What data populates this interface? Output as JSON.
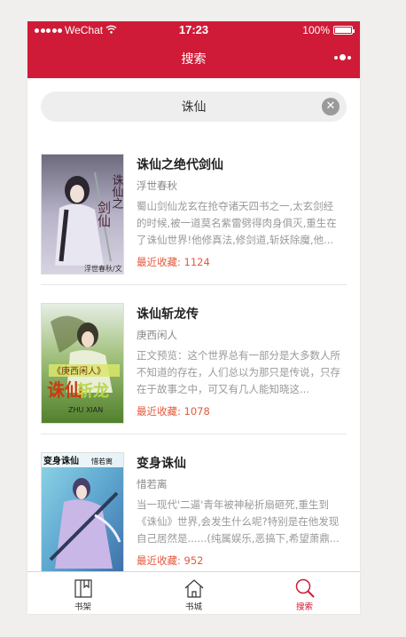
{
  "status_bar": {
    "carrier": "WeChat",
    "time": "17:23",
    "battery": "100%"
  },
  "nav": {
    "title": "搜索",
    "more_icon": "more-dots-icon"
  },
  "search": {
    "value": "诛仙",
    "clear_icon": "clear-icon"
  },
  "books": [
    {
      "title": "诛仙之绝代剑仙",
      "author": "浮世春秋",
      "description": "蜀山剑仙龙玄在抢夺诸天四书之一,太玄剑经的时候,被一道莫名紫雷劈得肉身俱灭,重生在了诛仙世界!他修真法,修剑道,斩妖除魔,他...",
      "favorites": "最近收藏: 1124",
      "cover_text": "诛仙之绝代剑仙",
      "cover_author": "浮世春秋/文"
    },
    {
      "title": "诛仙斩龙传",
      "author": "庚西闲人",
      "description": "正文预览：这个世界总有一部分是大多数人所不知道的存在，人们总以为那只是传说，只存在于故事之中，可又有几人能知晓这...",
      "favorites": "最近收藏: 1078",
      "cover_text": "诛仙斩龙传",
      "cover_author": "庚西闲人"
    },
    {
      "title": "变身诛仙",
      "author": "惜若离",
      "description": "当一现代'二逼'青年被神秘折扇砸死,重生到《诛仙》世界,会发生什么呢?特别是在他发现自己居然是......(纯属娱乐,恶搞下,希望萧鼎...",
      "favorites": "最近收藏: 952",
      "cover_text": "变身诛仙",
      "cover_author": "惜若离"
    }
  ],
  "tabs": [
    {
      "label": "书架",
      "icon": "bookshelf-icon",
      "active": false
    },
    {
      "label": "书城",
      "icon": "home-icon",
      "active": false
    },
    {
      "label": "搜索",
      "icon": "search-icon",
      "active": true
    }
  ],
  "colors": {
    "brand": "#cf1b37",
    "favorite_text": "#e45a3c"
  }
}
